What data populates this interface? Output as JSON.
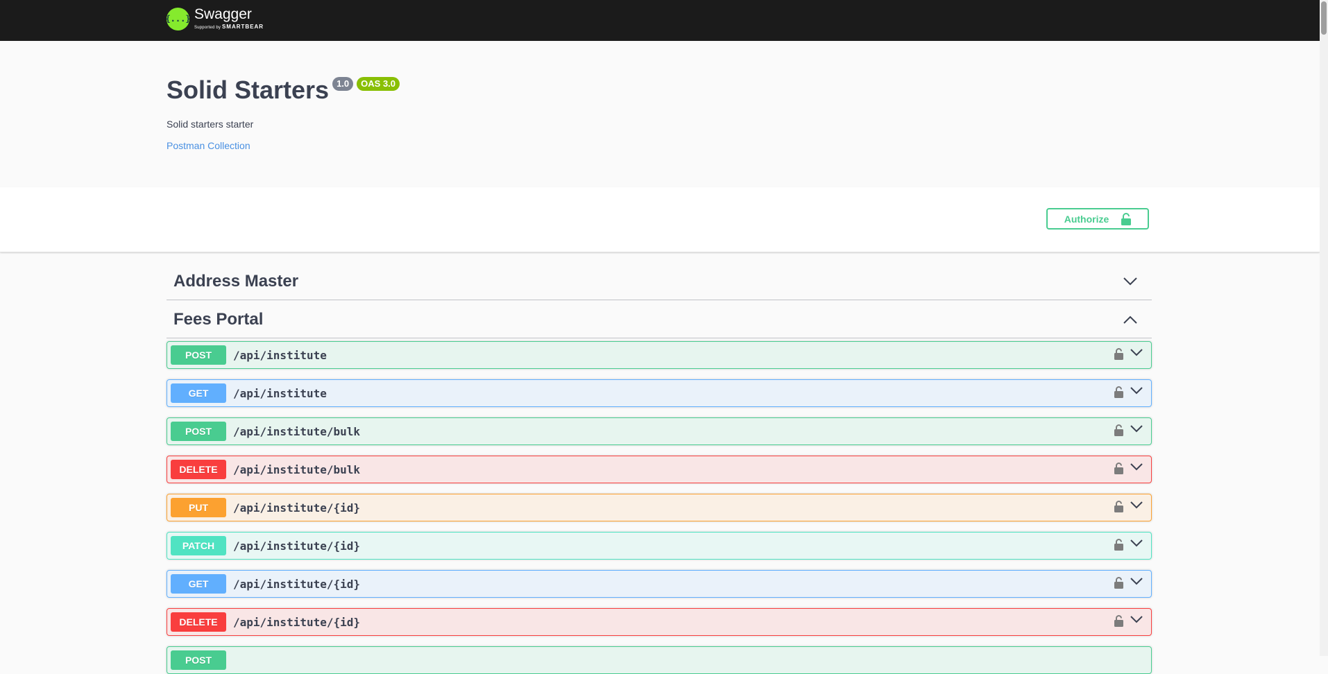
{
  "topbar": {
    "logo_icon_text": "{...}",
    "logo_name": "Swagger",
    "logo_sub_prefix": "Supported by",
    "logo_sub_brand": "SMARTBEAR"
  },
  "info": {
    "title": "Solid Starters",
    "version_badge": "1.0",
    "oas_badge": "OAS 3.0",
    "description": "Solid starters starter",
    "postman_link": "Postman Collection"
  },
  "auth": {
    "authorize_label": "Authorize"
  },
  "tags": [
    {
      "title": "Address Master",
      "expanded": false
    },
    {
      "title": "Fees Portal",
      "expanded": true
    }
  ],
  "operations": [
    {
      "method": "POST",
      "path": "/api/institute"
    },
    {
      "method": "GET",
      "path": "/api/institute"
    },
    {
      "method": "POST",
      "path": "/api/institute/bulk"
    },
    {
      "method": "DELETE",
      "path": "/api/institute/bulk"
    },
    {
      "method": "PUT",
      "path": "/api/institute/{id}"
    },
    {
      "method": "PATCH",
      "path": "/api/institute/{id}"
    },
    {
      "method": "GET",
      "path": "/api/institute/{id}"
    },
    {
      "method": "DELETE",
      "path": "/api/institute/{id}"
    },
    {
      "method": "POST",
      "path": ""
    }
  ],
  "colors": {
    "post": "#49cc90",
    "get": "#61affe",
    "delete": "#f93e3e",
    "put": "#fca130",
    "patch": "#50e3c2",
    "link": "#4990e2",
    "topbar": "#1b1b1b"
  }
}
